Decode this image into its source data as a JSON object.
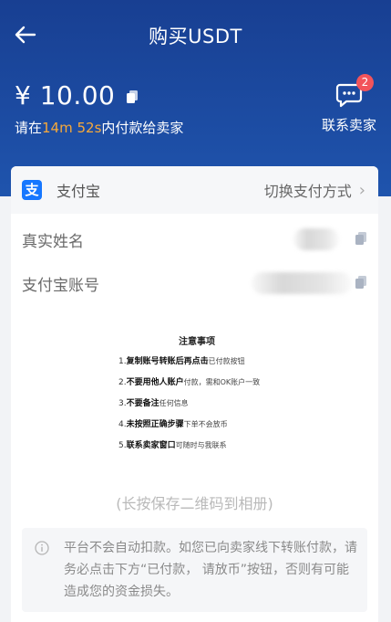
{
  "header": {
    "title": "购买USDT",
    "amount": "¥ 10.00",
    "deadline_prefix": "请在",
    "deadline_timer": "14m 52s",
    "deadline_suffix": "内付款给卖家",
    "contact_label": "联系卖家",
    "contact_badge": "2"
  },
  "payment": {
    "method_name": "支付宝",
    "logo_glyph": "支",
    "switch_label": "切换支付方式",
    "fields": [
      {
        "label": "真实姓名"
      },
      {
        "label": "支付宝账号"
      }
    ]
  },
  "notice": {
    "title": "注意事项",
    "items": [
      {
        "num": "1.",
        "bold": "复制账号转账后再点击",
        "normal": "已付款按钮"
      },
      {
        "num": "2.",
        "bold": "不要用他人账户",
        "normal": "付款，需和OK账户一致"
      },
      {
        "num": "3.",
        "bold": "不要备注",
        "normal": "任何信息"
      },
      {
        "num": "4.",
        "bold": "未按照正确步骤",
        "normal": "下单不会放币"
      },
      {
        "num": "5.",
        "bold": "联系卖家窗口",
        "normal": "可随时与我联系"
      }
    ]
  },
  "save_hint": "(长按保存二维码到相册)",
  "warning": "平台不会自动扣款。如您已向卖家线下转账付款，请务必点击下方“已付款，  请放币”按钮，否则有可能造成您的资金损失。",
  "colors": {
    "header_bg": "#1e4fa3",
    "timer": "#f7a93a",
    "badge": "#f2545b",
    "alipay": "#1677ff"
  }
}
